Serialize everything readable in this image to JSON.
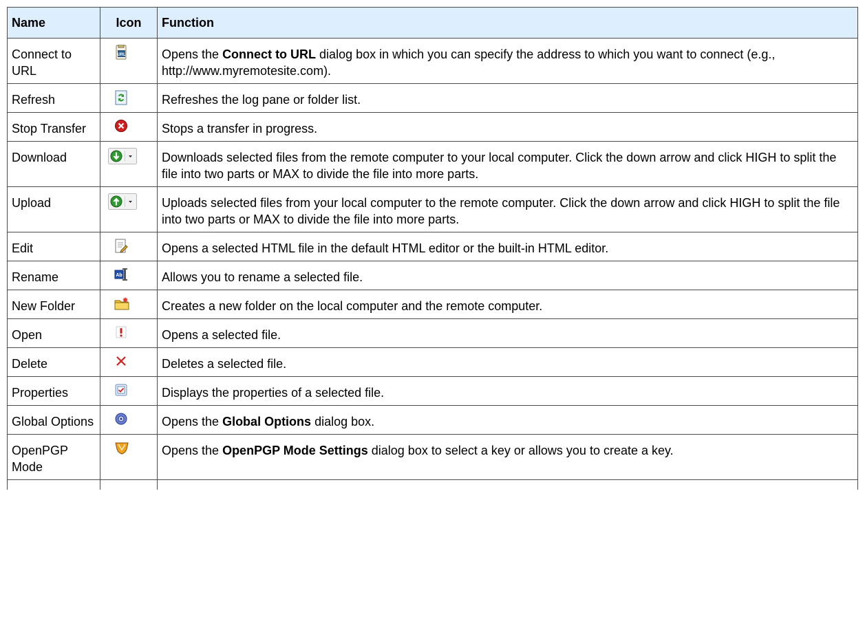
{
  "headers": {
    "name": "Name",
    "icon": "Icon",
    "function": "Function"
  },
  "rows": [
    {
      "name": "Connect to URL",
      "icon": "connect-url-icon",
      "func": [
        "Opens the ",
        {
          "b": "Connect to URL"
        },
        " dialog box in which you can specify the address to which you want to connect (e.g., http://www.myremotesite.com)."
      ]
    },
    {
      "name": "Refresh",
      "icon": "refresh-icon",
      "func": [
        "Refreshes the log pane or folder list."
      ]
    },
    {
      "name": "Stop Transfer",
      "icon": "stop-icon",
      "func": [
        "Stops a transfer in progress."
      ]
    },
    {
      "name": "Download",
      "icon": "download-icon",
      "func": [
        "Downloads selected files from the remote computer to your local computer. Click the down arrow and click HIGH to split the file into two parts or MAX to divide the file into more parts."
      ]
    },
    {
      "name": "Upload",
      "icon": "upload-icon",
      "func": [
        "Uploads selected files from your local computer to the remote computer. Click the down arrow and click HIGH to split the file into two parts or MAX to divide the file into more parts."
      ]
    },
    {
      "name": "Edit",
      "icon": "edit-icon",
      "func": [
        "Opens a selected HTML file in the default HTML editor or the built-in HTML editor."
      ]
    },
    {
      "name": "Rename",
      "icon": "rename-icon",
      "func": [
        "Allows you to rename a selected file."
      ]
    },
    {
      "name": "New Folder",
      "icon": "new-folder-icon",
      "func": [
        "Creates a new folder on the local computer and the remote computer."
      ]
    },
    {
      "name": "Open",
      "icon": "open-icon",
      "func": [
        "Opens a selected file."
      ]
    },
    {
      "name": "Delete",
      "icon": "delete-icon",
      "func": [
        "Deletes a selected file."
      ]
    },
    {
      "name": "Properties",
      "icon": "properties-icon",
      "func": [
        "Displays the properties of a selected file."
      ]
    },
    {
      "name": "Global Options",
      "icon": "global-options-icon",
      "func": [
        "Opens the ",
        {
          "b": "Global Options"
        },
        " dialog box."
      ]
    },
    {
      "name": "OpenPGP Mode",
      "icon": "openpgp-icon",
      "func": [
        "Opens the ",
        {
          "b": "OpenPGP Mode Settings"
        },
        " dialog box to select a key or allows you to create a key."
      ]
    }
  ]
}
